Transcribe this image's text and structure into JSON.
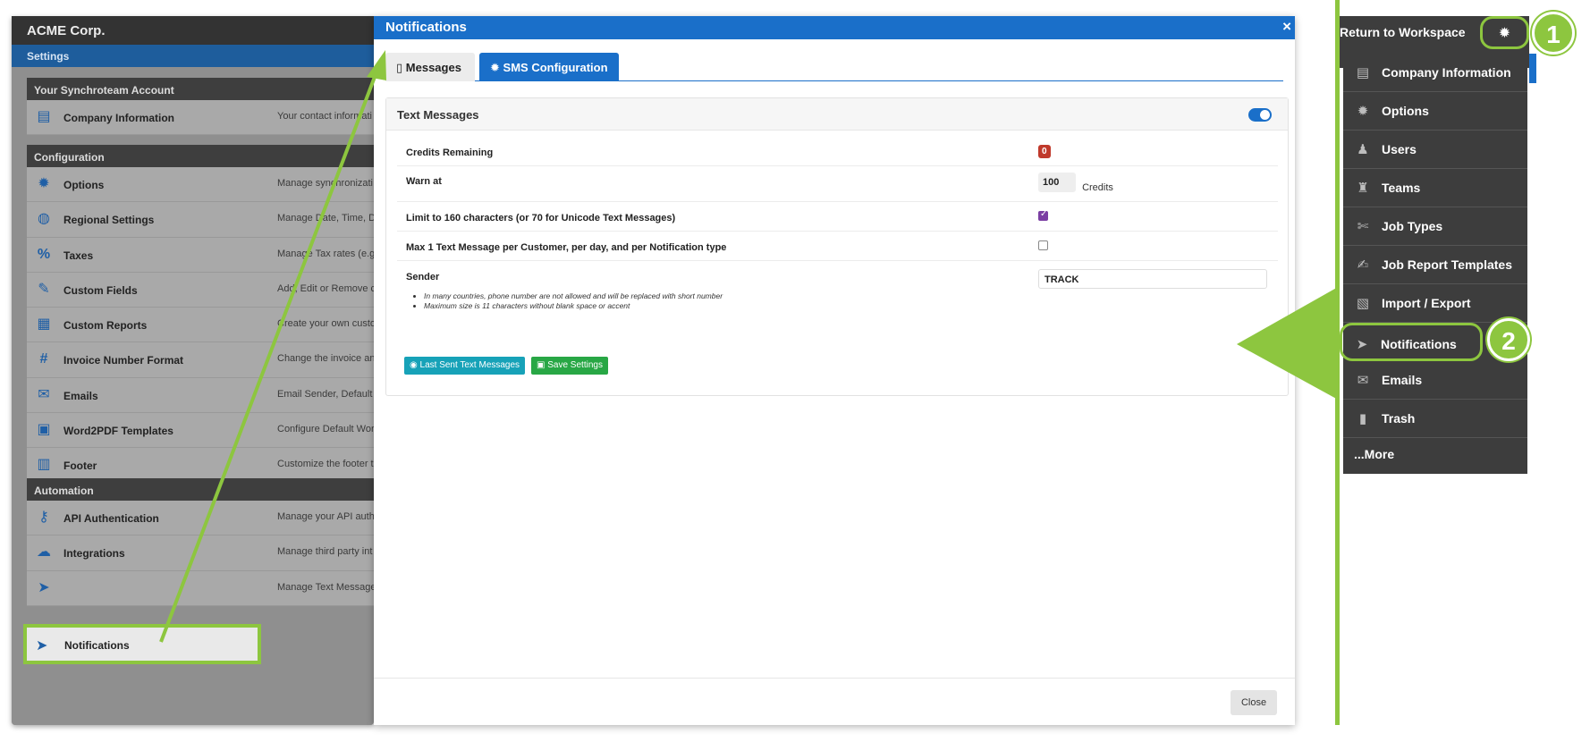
{
  "settings": {
    "title": "ACME Corp.",
    "subtitle": "Settings",
    "sections": [
      {
        "header": "Your Synchroteam Account",
        "rows": [
          {
            "icon": "id-card-icon",
            "glyph": "▤",
            "name": "Company Information",
            "desc": "Your contact informati"
          }
        ]
      },
      {
        "header": "Configuration",
        "rows": [
          {
            "icon": "gear-icon",
            "glyph": "✹",
            "name": "Options",
            "desc": "Manage synchronizati"
          },
          {
            "icon": "globe-icon",
            "glyph": "◍",
            "name": "Regional Settings",
            "desc": "Manage Date, Time, D"
          },
          {
            "icon": "percent-icon",
            "glyph": "%",
            "name": "Taxes",
            "desc": "Manage Tax rates (e.g"
          },
          {
            "icon": "edit-icon",
            "glyph": "✎",
            "name": "Custom Fields",
            "desc": "Add, Edit or Remove c"
          },
          {
            "icon": "report-icon",
            "glyph": "▦",
            "name": "Custom Reports",
            "desc": "Create your own custo"
          },
          {
            "icon": "hash-icon",
            "glyph": "#",
            "name": "Invoice Number Format",
            "desc": "Change the invoice an"
          },
          {
            "icon": "mail-tray-icon",
            "glyph": "✉",
            "name": "Emails",
            "desc": "Email Sender, Default"
          },
          {
            "icon": "pdf-icon",
            "glyph": "▣",
            "name": "Word2PDF Templates",
            "desc": "Configure Default Wor"
          },
          {
            "icon": "footer-icon",
            "glyph": "▥",
            "name": "Footer",
            "desc": "Customize the footer t"
          }
        ]
      },
      {
        "header": "Automation",
        "rows": [
          {
            "icon": "key-icon",
            "glyph": "⚷",
            "name": "API Authentication",
            "desc": "Manage your API auth"
          },
          {
            "icon": "cloud-icon",
            "glyph": "☁",
            "name": "Integrations",
            "desc": "Manage third party int"
          },
          {
            "icon": "paper-plane-icon",
            "glyph": "➤",
            "name": "",
            "desc": "Manage Text Message"
          }
        ]
      }
    ],
    "highlighted_item": "Notifications"
  },
  "modal": {
    "title": "Notifications",
    "close_x": "×",
    "tabs": [
      {
        "label": "Messages",
        "icon": "document-icon"
      },
      {
        "label": "SMS Configuration",
        "icon": "gear-icon"
      }
    ],
    "panel": {
      "title": "Text Messages",
      "fields": {
        "credits": {
          "label": "Credits Remaining",
          "value": "0"
        },
        "warn": {
          "label": "Warn at",
          "value": "100",
          "unit": "Credits"
        },
        "limit": {
          "label": "Limit to 160 characters (or 70 for Unicode Text Messages)"
        },
        "max": {
          "label": "Max 1 Text Message per Customer, per day, and per Notification type"
        },
        "sender": {
          "label": "Sender",
          "value": "TRACK",
          "hints": [
            "In many countries, phone number are not allowed and will be replaced with short number",
            "Maximum size is 11 characters without blank space or accent"
          ]
        }
      },
      "buttons": {
        "last_sent": "Last Sent Text Messages",
        "save": "Save Settings"
      }
    },
    "close_button": "Close"
  },
  "side_menu": {
    "return_label": "Return to Workspace",
    "items": [
      {
        "icon": "id-card-icon",
        "glyph": "▤",
        "label": "Company Information"
      },
      {
        "icon": "gear-icon",
        "glyph": "✹",
        "label": "Options"
      },
      {
        "icon": "user-edit-icon",
        "glyph": "♟",
        "label": "Users"
      },
      {
        "icon": "team-icon",
        "glyph": "♜",
        "label": "Teams"
      },
      {
        "icon": "wrench-icon",
        "glyph": "✄",
        "label": "Job Types"
      },
      {
        "icon": "report-edit-icon",
        "glyph": "✍",
        "label": "Job Report Templates"
      },
      {
        "icon": "csv-file-icon",
        "glyph": "▧",
        "label": "Import / Export"
      },
      {
        "icon": "paper-plane-icon",
        "glyph": "➤",
        "label": "Notifications"
      },
      {
        "icon": "mail-tray-icon",
        "glyph": "✉",
        "label": "Emails"
      },
      {
        "icon": "trash-icon",
        "glyph": "▮",
        "label": "Trash"
      }
    ],
    "more_label": "...More"
  },
  "callouts": [
    "1",
    "2"
  ],
  "colors": {
    "accent_green": "#8dc63f",
    "primary_blue": "#1a6fc9",
    "danger_red": "#c0392b",
    "info_teal": "#17a2b8",
    "success_green": "#28a745"
  }
}
